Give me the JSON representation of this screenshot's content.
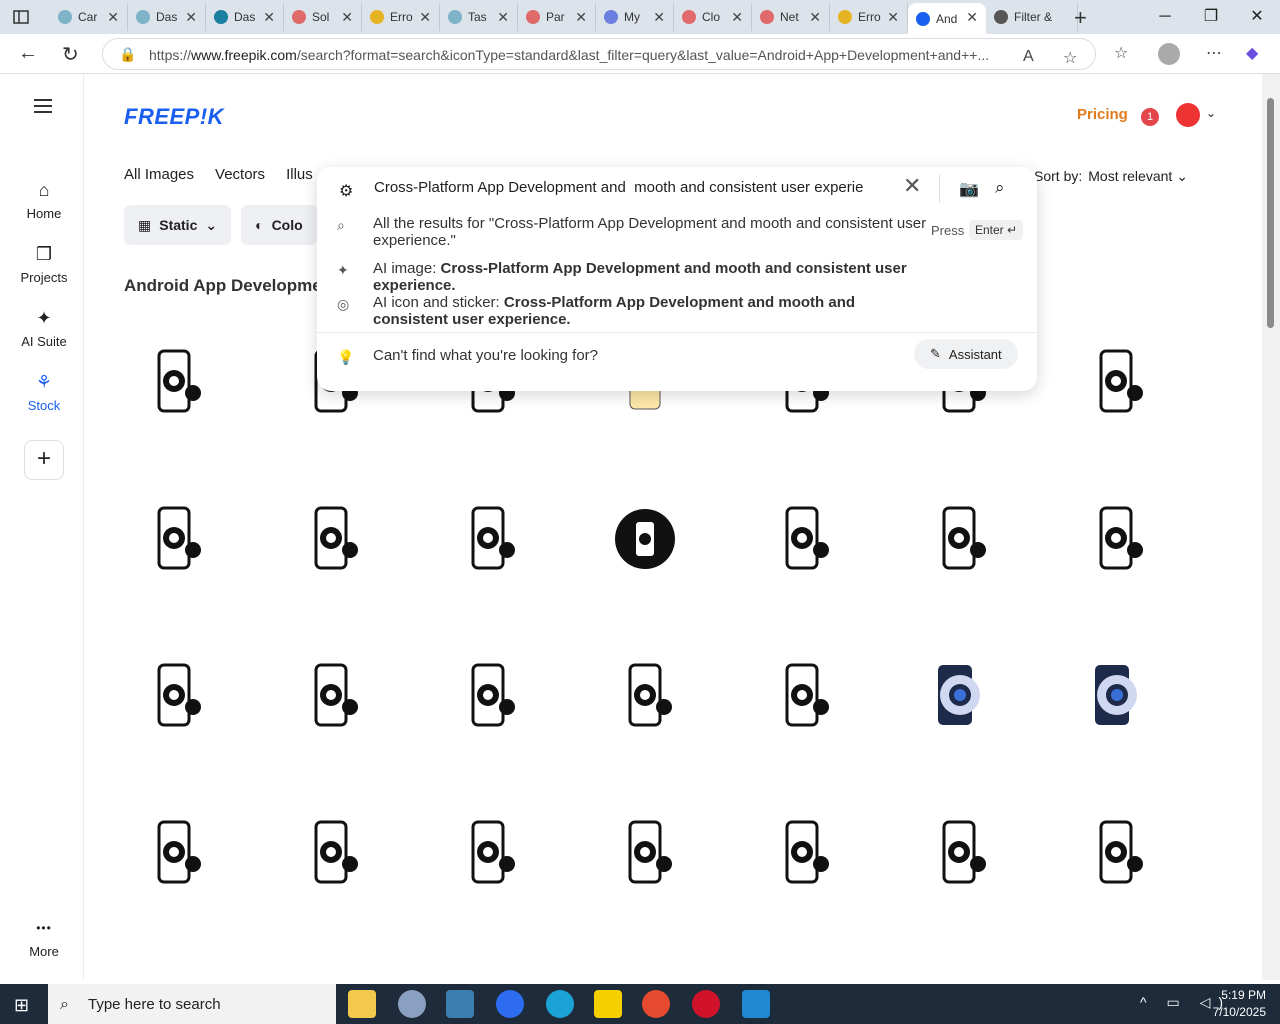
{
  "browser": {
    "tabs": [
      {
        "label": "Car",
        "color": "#7fb3c8"
      },
      {
        "label": "Das",
        "color": "#7fb3c8"
      },
      {
        "label": "Das",
        "color": "#1a7fa0"
      },
      {
        "label": "Sol",
        "color": "#e06a6a"
      },
      {
        "label": "Erro",
        "color": "#e6b422"
      },
      {
        "label": "Tas",
        "color": "#7fb3c8"
      },
      {
        "label": "Par",
        "color": "#e06a6a"
      },
      {
        "label": "My",
        "color": "#6b7fe0"
      },
      {
        "label": "Clo",
        "color": "#e06a6a"
      },
      {
        "label": "Net",
        "color": "#e06a6a"
      },
      {
        "label": "Erro",
        "color": "#e6b422"
      },
      {
        "label": "And",
        "color": "#1a5ff0",
        "active": true
      },
      {
        "label": "Filter &",
        "color": "#555555"
      }
    ],
    "url_prefix": "https://",
    "url_domain": "www.freepik.com",
    "url_rest": "/search?format=search&iconType=standard&last_filter=query&last_value=Android+App+Development+and++..."
  },
  "sidebar": {
    "items": [
      {
        "label": "Home",
        "icon": "home-icon",
        "glyph": "⌂"
      },
      {
        "label": "Projects",
        "icon": "projects-icon",
        "glyph": "❐"
      },
      {
        "label": "AI Suite",
        "icon": "ai-suite-icon",
        "glyph": "✦"
      },
      {
        "label": "Stock",
        "icon": "stock-icon",
        "glyph": "⚘",
        "active": true
      }
    ],
    "add_glyph": "+",
    "more_label": "More",
    "more_glyph": "•••"
  },
  "header": {
    "logo": "FREEP!K",
    "pricing": "Pricing",
    "notification_count": "1"
  },
  "categories": [
    "All Images",
    "Vectors",
    "Illus"
  ],
  "filters": [
    {
      "label": "Static",
      "icon": "static-icon"
    },
    {
      "label": "Colo",
      "icon": "color-icon"
    }
  ],
  "sort": {
    "label": "Sort by:",
    "value": "Most relevant"
  },
  "heading": "Android App Developme",
  "search": {
    "value": "Cross-Platform App Development and  mooth and consistent user experie",
    "suggestions": [
      {
        "prefix": "All the results for \"Cross-Platform App Development and mooth and consistent user experience.\"",
        "bold": ""
      },
      {
        "prefix": "AI image: ",
        "bold": "Cross-Platform App Development and mooth and consistent user experience."
      },
      {
        "prefix": "AI icon and sticker: ",
        "bold": "Cross-Platform App Development and mooth and consistent user experience."
      }
    ],
    "press": "Press",
    "enter": "Enter ↵",
    "cant_find": "Can't find what you're looking for?",
    "assistant": "Assistant"
  },
  "taskbar": {
    "search_placeholder": "Type here to search",
    "time": "5:19 PM",
    "date": "7/10/2025"
  }
}
